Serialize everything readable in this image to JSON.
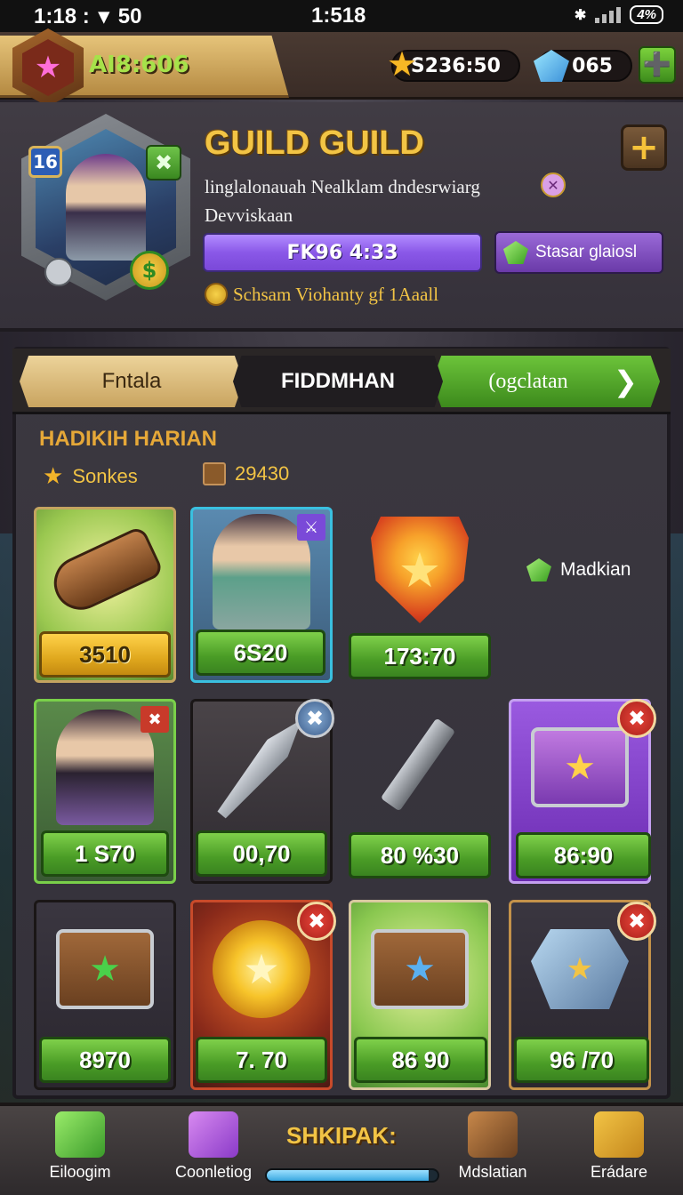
{
  "status_bar": {
    "time_left": "1:18 :",
    "signal_value": "50",
    "time_center": "1:518",
    "battery": "4%"
  },
  "player": {
    "id_label": "AI8:606"
  },
  "currencies": {
    "gold": "S236:50",
    "gems": "065",
    "add_icon": "plus-icon"
  },
  "guild": {
    "level": "16",
    "title": "GUILD GUILD",
    "description_line1": "linglalonauah Nealklam dndesrwiarg",
    "description_line2": "Devviskaan",
    "timer": "FK96 4:33",
    "status_button": "Stasar glaiosl",
    "reward_text": "Schsam Viohanty gf 1Aaall"
  },
  "tabs": [
    {
      "label": "Fntala"
    },
    {
      "label": "FIDDMHAN"
    },
    {
      "label": "(ogclatan"
    }
  ],
  "section": {
    "title": "HADIKIH HARIAN",
    "stat1_label": "Sonkes",
    "stat2_value": "29430"
  },
  "shop": {
    "side_label": "Madkian",
    "items": [
      {
        "name": "cannon",
        "price": "3510"
      },
      {
        "name": "hero-archer",
        "price": "6S20"
      },
      {
        "name": "shield",
        "price": "173:70"
      },
      {
        "name": "hero-mage",
        "price": "1 S70"
      },
      {
        "name": "crossbow-blade",
        "price": "00,70"
      },
      {
        "name": "axe",
        "price": "80 %30"
      },
      {
        "name": "purple-chest",
        "price": "86:90"
      },
      {
        "name": "wooden-chest",
        "price": "8970"
      },
      {
        "name": "gold-coins",
        "price": "7. 70"
      },
      {
        "name": "blue-chest",
        "price": "86 90"
      },
      {
        "name": "crystal-box",
        "price": "96 /70"
      }
    ]
  },
  "bottom_nav": {
    "center_title": "SHKIPAK:",
    "progress": 0.95,
    "items": [
      {
        "label": "Eiloogim"
      },
      {
        "label": "Coonletiog"
      },
      {
        "label": "Mdslatian"
      },
      {
        "label": "Erádare"
      }
    ]
  },
  "colors": {
    "accent_gold": "#f2c445",
    "price_green": "#4a9c26",
    "timer_purple": "#8a58e8"
  }
}
